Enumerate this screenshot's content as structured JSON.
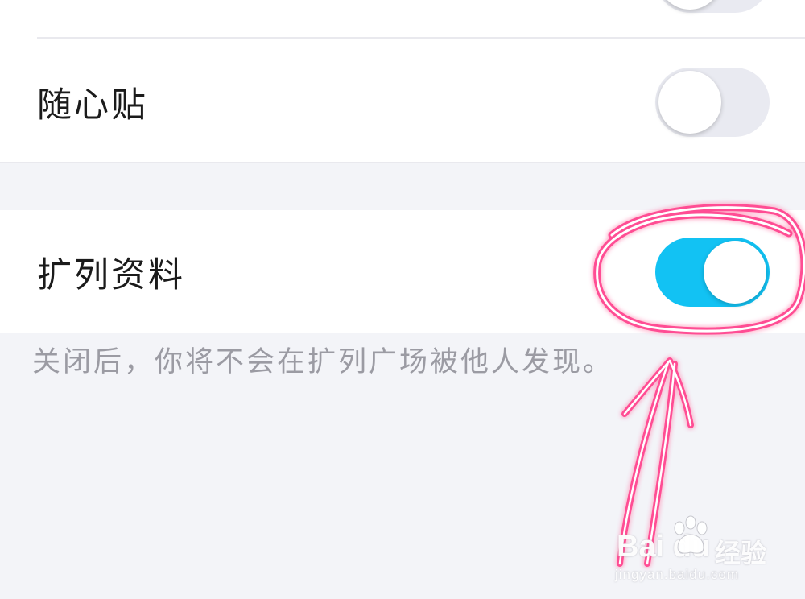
{
  "settings": {
    "rows": [
      {
        "label": "随心贴",
        "enabled": false
      },
      {
        "label": "扩列资料",
        "enabled": true
      }
    ],
    "hint": "关闭后，你将不会在扩列广场被他人发现。"
  },
  "colors": {
    "toggle_on": "#12c2f3",
    "toggle_off": "#e9eaf1",
    "background": "#f3f4f8",
    "annotation": "#ff3f8a"
  },
  "watermark": {
    "brand": "Bai du",
    "brand_cn": "经验",
    "url": "jingyan.baidu.com",
    "icon": "paw-icon"
  }
}
